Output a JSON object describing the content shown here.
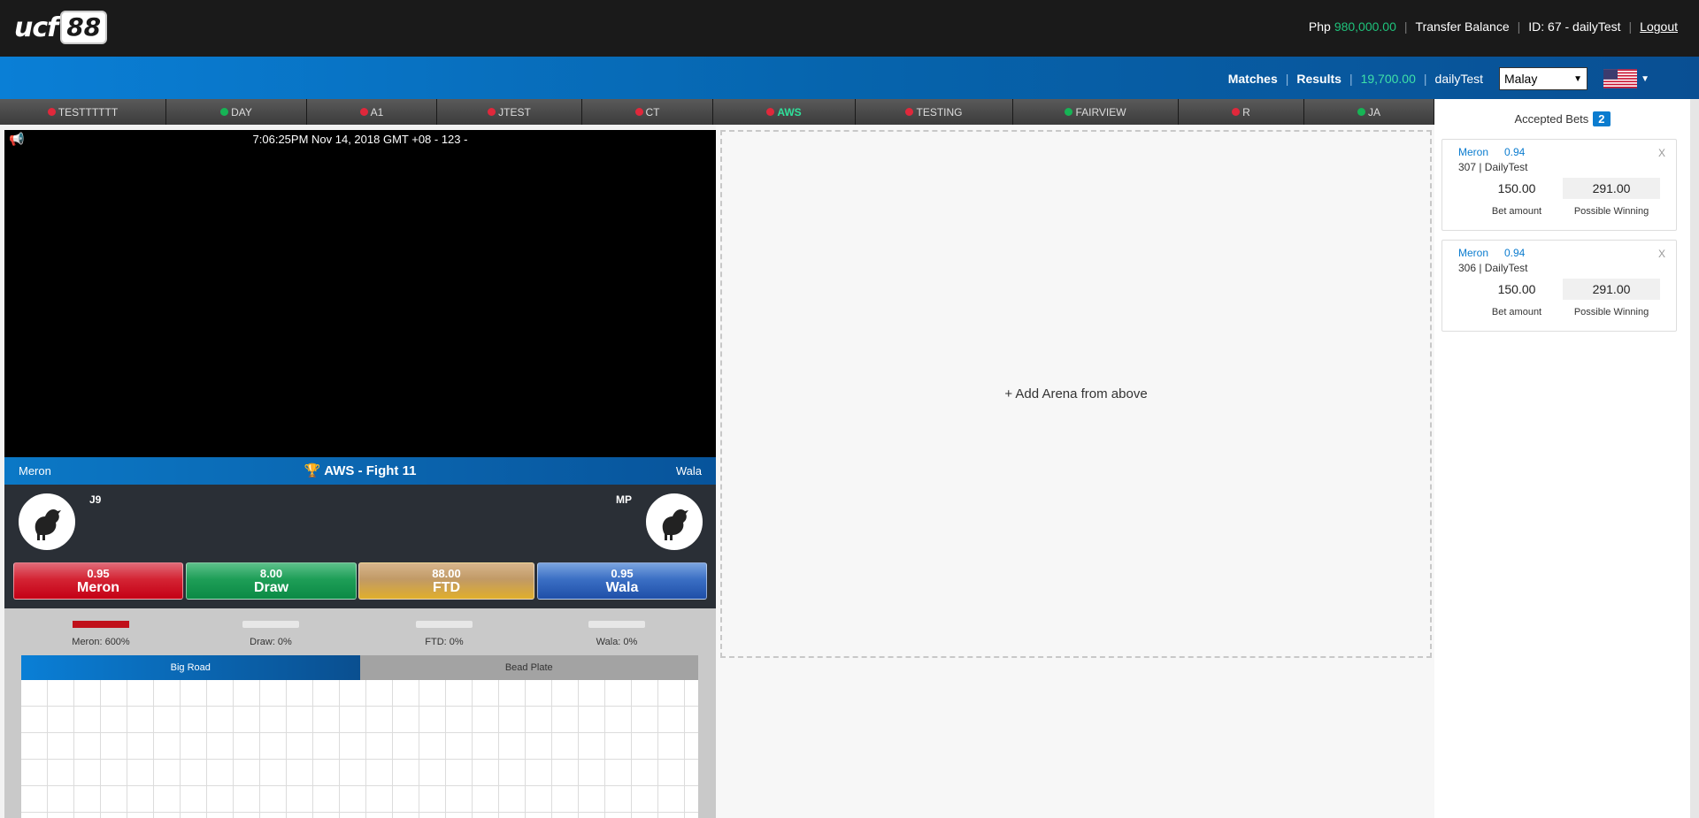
{
  "header": {
    "logo_text": "ucf",
    "logo_number": "88",
    "currency": "Php",
    "amount": "980,000.00",
    "transfer": "Transfer Balance",
    "user_id": "ID: 67 - dailyTest",
    "logout": "Logout"
  },
  "nav": {
    "matches": "Matches",
    "results": "Results",
    "balance": "19,700.00",
    "username": "dailyTest",
    "language": "Malay",
    "flag_icon": "us-flag-icon"
  },
  "tabs": [
    {
      "label": "TESTTTTTT",
      "status": "red"
    },
    {
      "label": "DAY",
      "status": "green"
    },
    {
      "label": "A1",
      "status": "red"
    },
    {
      "label": "JTEST",
      "status": "red"
    },
    {
      "label": "CT",
      "status": "red"
    },
    {
      "label": "AWS",
      "status": "red"
    },
    {
      "label": "TESTING",
      "status": "red"
    },
    {
      "label": "FAIRVIEW",
      "status": "green"
    },
    {
      "label": "R",
      "status": "red"
    },
    {
      "label": "JA",
      "status": "green"
    }
  ],
  "colors": {
    "status_red": "#e0283b",
    "status_green": "#16b455",
    "accent_blue": "#0b7ccf"
  },
  "video": {
    "timestamp": "7:06:25PM Nov 14, 2018 GMT +08 - 123 -"
  },
  "fight": {
    "left_label": "Meron",
    "right_label": "Wala",
    "title": "AWS - Fight 11",
    "left_fighter": "J9",
    "right_fighter": "MP"
  },
  "bets": {
    "meron": {
      "odds": "0.95",
      "label": "Meron"
    },
    "draw": {
      "odds": "8.00",
      "label": "Draw"
    },
    "ftd": {
      "odds": "88.00",
      "label": "FTD"
    },
    "wala": {
      "odds": "0.95",
      "label": "Wala"
    }
  },
  "stats": {
    "meron": "Meron: 600%",
    "draw": "Draw: 0%",
    "ftd": "FTD: 0%",
    "wala": "Wala: 0%",
    "meron_fill": 1.0,
    "draw_fill": 0,
    "ftd_fill": 0,
    "wala_fill": 0
  },
  "road_tabs": {
    "big_road": "Big Road",
    "bead_plate": "Bead Plate"
  },
  "arena": {
    "add_text": "+ Add Arena from above"
  },
  "accepted": {
    "title": "Accepted Bets",
    "count": "2",
    "items": [
      {
        "side": "Meron",
        "odds": "0.94",
        "close": "X",
        "ticket": "307 | DailyTest",
        "amount": "150.00",
        "winning": "291.00",
        "amount_label": "Bet amount",
        "winning_label": "Possible Winning"
      },
      {
        "side": "Meron",
        "odds": "0.94",
        "close": "X",
        "ticket": "306 | DailyTest",
        "amount": "150.00",
        "winning": "291.00",
        "amount_label": "Bet amount",
        "winning_label": "Possible Winning"
      }
    ]
  }
}
